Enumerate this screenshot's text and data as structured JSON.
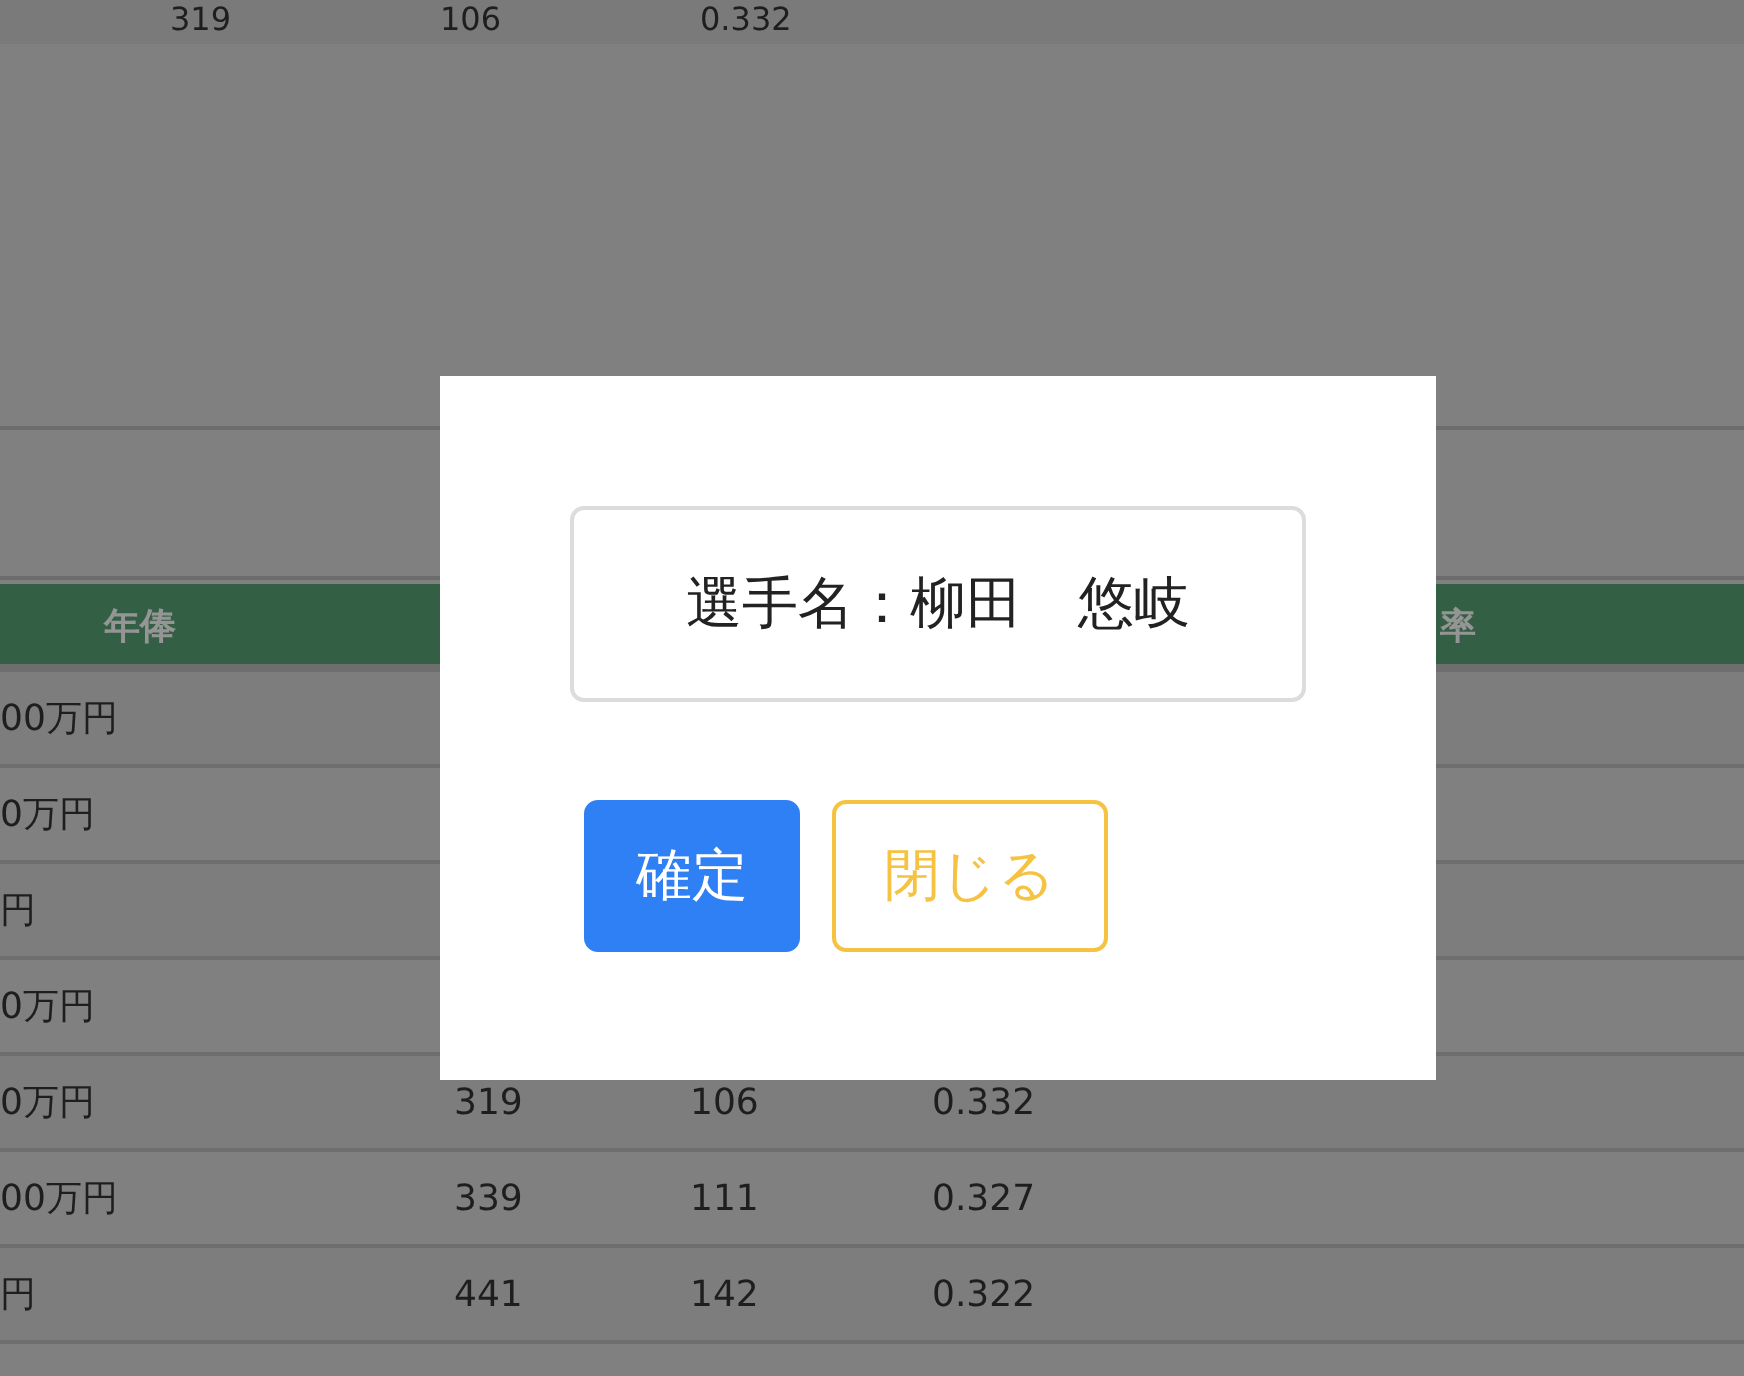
{
  "background_table": {
    "top_row": [
      "319",
      "106",
      "0.332"
    ],
    "header": [
      "年俸",
      "率"
    ],
    "rows": [
      {
        "cells": [
          "00万円"
        ]
      },
      {
        "cells": [
          "0万円"
        ]
      },
      {
        "cells": [
          "円"
        ]
      },
      {
        "cells": [
          "0万円"
        ]
      },
      {
        "cells": [
          "0万円",
          "319",
          "106",
          "0.332"
        ]
      },
      {
        "cells": [
          "00万円",
          "339",
          "111",
          "0.327"
        ]
      },
      {
        "cells": [
          "円",
          "441",
          "142",
          "0.322"
        ]
      }
    ]
  },
  "dialog": {
    "player_name": "選手名：柳田　悠岐",
    "buttons": [
      {
        "label": "確定",
        "kind": "primary"
      },
      {
        "label": "閉じる",
        "kind": "outline-warning"
      }
    ]
  }
}
